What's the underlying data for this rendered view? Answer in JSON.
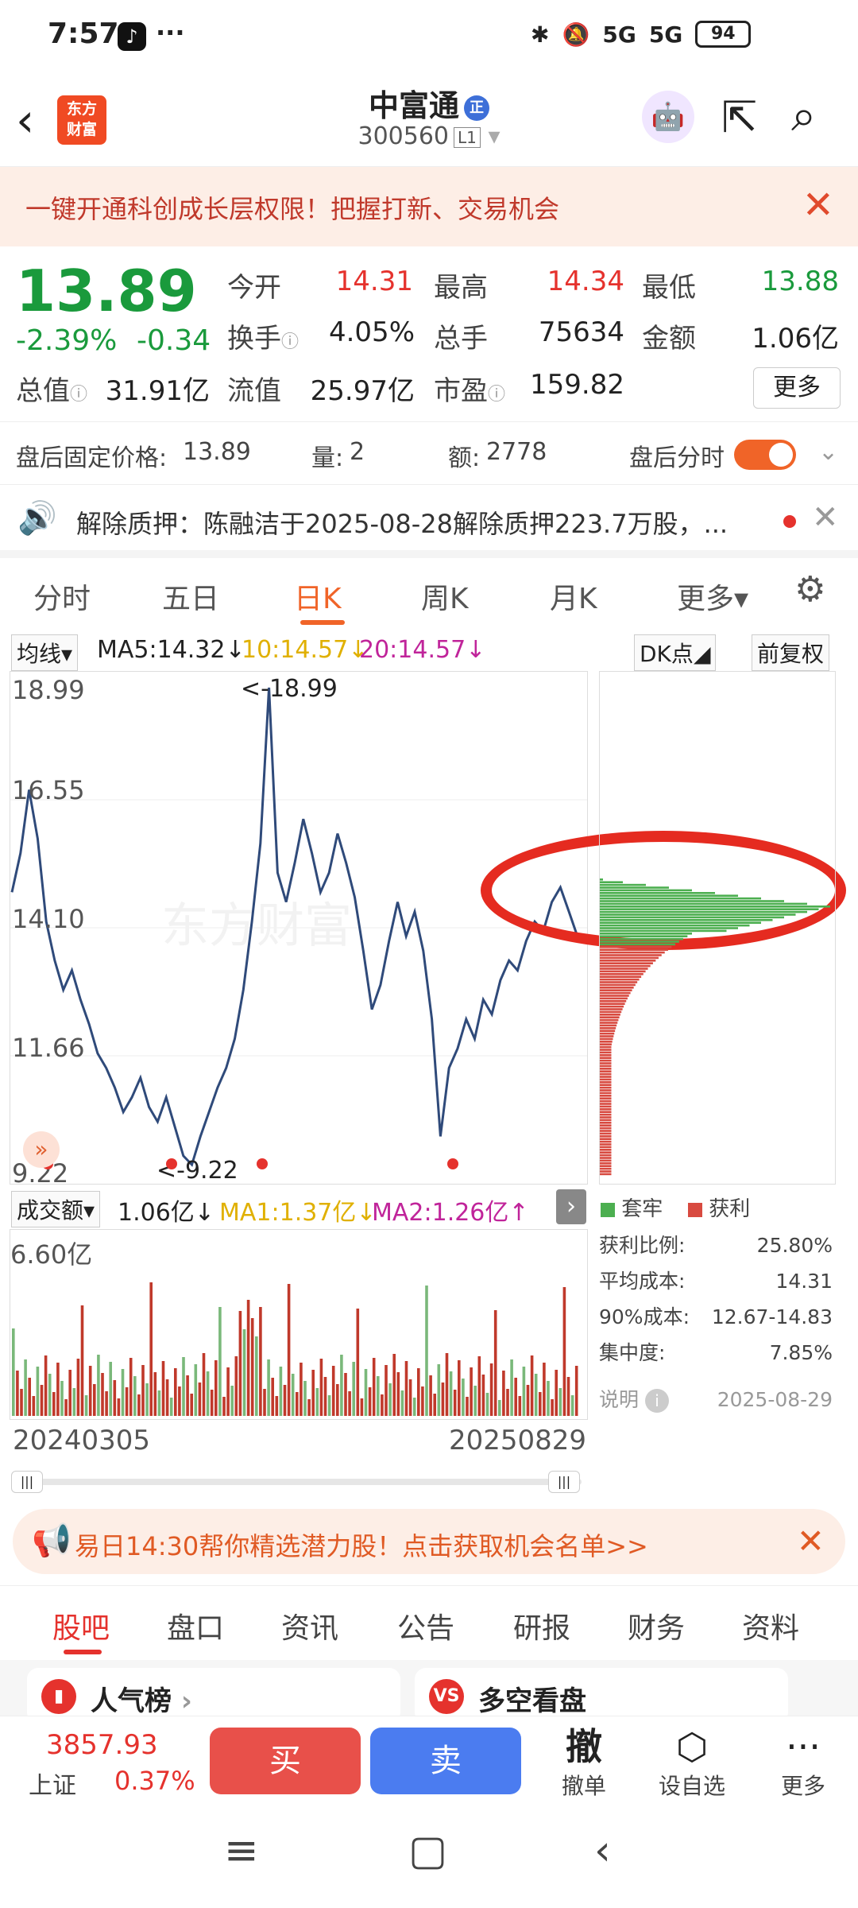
{
  "status": {
    "time": "7:57",
    "dots": "···",
    "signal1": "5G",
    "signal2": "5G",
    "battery": "94"
  },
  "header": {
    "logo_line1": "东方",
    "logo_line2": "财富",
    "name": "中富通",
    "badge": "正",
    "code": "300560",
    "level": "L1"
  },
  "banner": {
    "text": "一键开通科创成长层权限！把握打新、交易机会"
  },
  "quote": {
    "price": "13.89",
    "change_pct": "-2.39%",
    "change": "-0.34",
    "open_lbl": "今开",
    "open": "14.31",
    "high_lbl": "最高",
    "high": "14.34",
    "low_lbl": "最低",
    "low": "13.88",
    "turnover_lbl": "换手",
    "turnover": "4.05%",
    "volume_lbl": "总手",
    "volume": "75634",
    "amount_lbl": "金额",
    "amount": "1.06亿",
    "mcap_lbl": "总值",
    "mcap": "31.91亿",
    "float_lbl": "流值",
    "float": "25.97亿",
    "pe_lbl": "市盈",
    "pe": "159.82",
    "more": "更多"
  },
  "afterhours": {
    "price_lbl": "盘后固定价格:",
    "price": "13.89",
    "vol_lbl": "量:",
    "vol": "2",
    "amt_lbl": "额:",
    "amt": "2778",
    "toggle_lbl": "盘后分时"
  },
  "notice": {
    "text": "解除质押：陈融洁于2025-08-28解除质押223.7万股，..."
  },
  "ktabs": [
    "分时",
    "五日",
    "日K",
    "周K",
    "月K",
    "更多▾"
  ],
  "marow": {
    "type": "均线",
    "ma5": "MA5:14.32↓",
    "ma10": "10:14.57↓",
    "ma20": "20:14.57↓",
    "dk": "DK点",
    "adj": "前复权"
  },
  "kchart": {
    "y1": "18.99",
    "y2": "16.55",
    "y3": "14.10",
    "y4": "11.66",
    "y5": "9.22",
    "max_lbl": "<-18.99",
    "min_lbl": "<-9.22",
    "watermark": "东方财富"
  },
  "chip": {
    "legend1": "套牢",
    "legend2": "获利"
  },
  "volrow": {
    "type": "成交额",
    "val": "1.06亿↓",
    "ma1": "MA1:1.37亿↓",
    "ma2": "MA2:1.26亿↑"
  },
  "volchart": {
    "y1": "6.60亿"
  },
  "chipstats": [
    {
      "k": "获利比例:",
      "v": "25.80%"
    },
    {
      "k": "平均成本:",
      "v": "14.31"
    },
    {
      "k": "90%成本:",
      "v": "12.67-14.83"
    },
    {
      "k": "集中度:",
      "v": "7.85%"
    },
    {
      "k": "说明",
      "v": "2025-08-29"
    }
  ],
  "dates": {
    "start": "20240305",
    "end": "20250829"
  },
  "promo": {
    "text": "易日14:30帮你精选潜力股！点击获取机会名单>>"
  },
  "btabs": [
    "股吧",
    "盘口",
    "资讯",
    "公告",
    "研报",
    "财务",
    "资料"
  ],
  "cards": {
    "c1": "人气榜",
    "c2": "多空看盘"
  },
  "tradebar": {
    "index_val": "3857.93",
    "index_name": "上证",
    "index_pct": "0.37%",
    "buy": "买",
    "sell": "卖",
    "cancel": "撤",
    "cancel_lbl": "撤单",
    "watch_lbl": "设自选",
    "more_lbl": "更多"
  },
  "chart_data": {
    "type": "line",
    "title": "",
    "x": [
      "20240305",
      "20250829"
    ],
    "ylim": [
      9.22,
      18.99
    ],
    "y_ticks": [
      18.99,
      16.55,
      14.1,
      11.66,
      9.22
    ],
    "series": [
      {
        "values": [
          14.8,
          15.6,
          16.9,
          15.9,
          14.2,
          13.4,
          12.8,
          13.2,
          12.6,
          12.1,
          11.5,
          11.2,
          10.8,
          10.3,
          10.6,
          11.0,
          10.4,
          10.1,
          10.6,
          10.0,
          9.4,
          9.22,
          9.8,
          10.3,
          10.8,
          11.2,
          11.8,
          12.8,
          14.2,
          15.8,
          18.99,
          15.2,
          14.6,
          15.4,
          16.3,
          15.6,
          14.8,
          15.2,
          16.0,
          15.4,
          14.7,
          13.6,
          12.4,
          12.9,
          13.8,
          14.6,
          13.9,
          14.4,
          13.6,
          12.2,
          9.8,
          11.2,
          11.6,
          12.2,
          11.8,
          12.6,
          12.3,
          13.0,
          13.4,
          13.2,
          13.8,
          14.2,
          14.0,
          14.6,
          14.9,
          14.4,
          13.89
        ]
      }
    ],
    "volume": {
      "ylim_top": "6.60亿"
    }
  }
}
